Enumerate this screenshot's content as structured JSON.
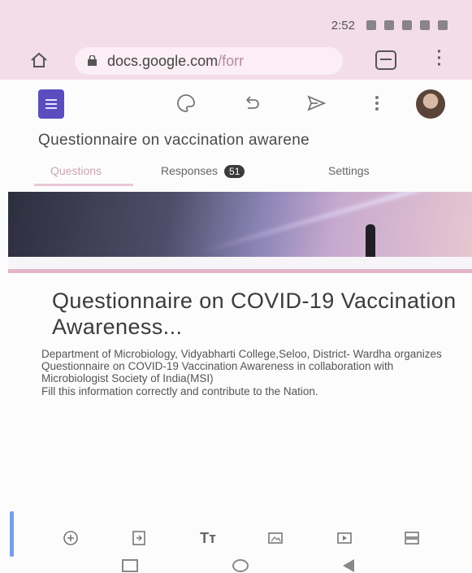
{
  "status_bar": {
    "time": "2:52"
  },
  "browser": {
    "url_main": "docs.google.com",
    "url_rest": "/forr"
  },
  "form": {
    "header_title": "Questionnaire on vaccination awarene",
    "tabs": [
      {
        "label": "Questions",
        "active": true
      },
      {
        "label": "Responses",
        "count": "51"
      },
      {
        "label": "Settings"
      }
    ],
    "title": "Questionnaire on COVID-19 Vaccination Awareness...",
    "description": "Department of Microbiology, Vidyabharti College,Seloo, District- Wardha organizes Questionnaire on COVID-19 Vaccination Awareness  in collaboration with Microbiologist Society of India(MSI)\nFill this information correctly and contribute to the Nation."
  },
  "toolbar_icons": [
    "palette-icon",
    "undo-icon",
    "send-icon",
    "more-icon"
  ],
  "bottom_icons": [
    "add-question-icon",
    "import-questions-icon",
    "add-title-icon",
    "add-image-icon",
    "add-video-icon",
    "add-section-icon"
  ],
  "icons": {
    "add_title_glyph": "Tт"
  },
  "colors": {
    "accent": "#e4b4c8",
    "forms_purple": "#5b4dbf",
    "active_tab": "#c9a5b4"
  }
}
